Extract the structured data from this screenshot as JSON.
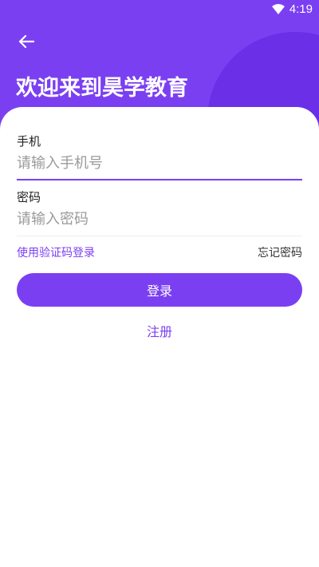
{
  "status_bar": {
    "time": "4:19"
  },
  "header": {
    "title": "欢迎来到昊学教育"
  },
  "form": {
    "phone": {
      "label": "手机",
      "placeholder": "请输入手机号"
    },
    "password": {
      "label": "密码",
      "placeholder": "请输入密码"
    },
    "sms_login_link": "使用验证码登录",
    "forgot_password_link": "忘记密码",
    "login_button": "登录",
    "register_link": "注册"
  },
  "colors": {
    "accent": "#7b3ff2",
    "accent_dark": "#6a2fe6"
  },
  "icons": {
    "back": "arrow-left-icon",
    "wifi": "wifi-icon"
  }
}
